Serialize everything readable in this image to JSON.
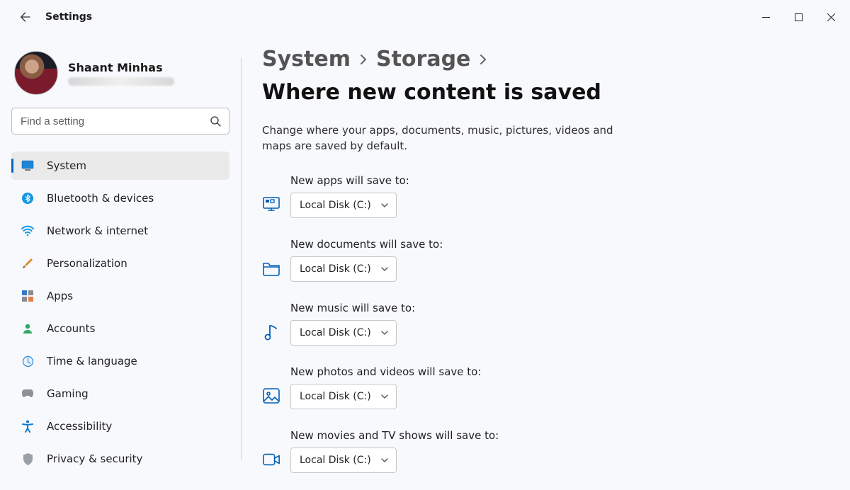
{
  "app": {
    "title": "Settings"
  },
  "profile": {
    "name": "Shaant Minhas"
  },
  "search": {
    "placeholder": "Find a setting"
  },
  "sidebar": {
    "items": [
      {
        "label": "System",
        "selected": true
      },
      {
        "label": "Bluetooth & devices"
      },
      {
        "label": "Network & internet"
      },
      {
        "label": "Personalization"
      },
      {
        "label": "Apps"
      },
      {
        "label": "Accounts"
      },
      {
        "label": "Time & language"
      },
      {
        "label": "Gaming"
      },
      {
        "label": "Accessibility"
      },
      {
        "label": "Privacy & security"
      }
    ]
  },
  "breadcrumb": {
    "level1": "System",
    "level2": "Storage",
    "current": "Where new content is saved"
  },
  "subtitle": "Change where your apps, documents, music, pictures, videos and maps are saved by default.",
  "rows": [
    {
      "label": "New apps will save to:",
      "value": "Local Disk (C:)"
    },
    {
      "label": "New documents will save to:",
      "value": "Local Disk (C:)"
    },
    {
      "label": "New music will save to:",
      "value": "Local Disk (C:)"
    },
    {
      "label": "New photos and videos will save to:",
      "value": "Local Disk (C:)"
    },
    {
      "label": "New movies and TV shows will save to:",
      "value": "Local Disk (C:)"
    }
  ]
}
